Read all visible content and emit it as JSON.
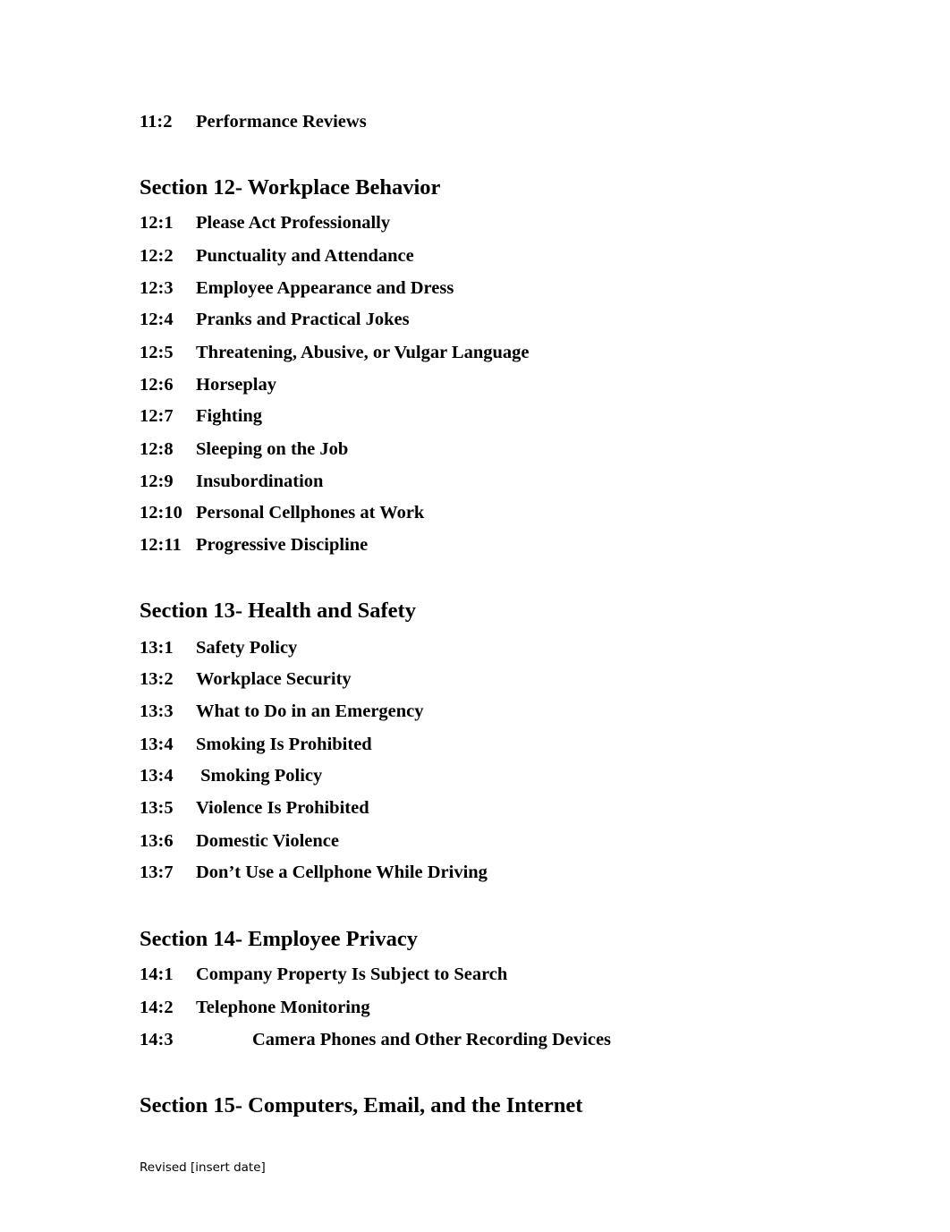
{
  "document": {
    "intro_entries": [
      {
        "num": "11:2",
        "title": "Performance Reviews"
      }
    ],
    "sections": [
      {
        "heading": "Section 12- Workplace Behavior",
        "entries": [
          {
            "num": "12:1",
            "title": "Please Act Professionally"
          },
          {
            "num": "12:2",
            "title": "Punctuality and Attendance"
          },
          {
            "num": "12:3",
            "title": "Employee Appearance and Dress"
          },
          {
            "num": "12:4",
            "title": "Pranks and Practical Jokes"
          },
          {
            "num": "12:5",
            "title": "Threatening, Abusive, or Vulgar Language"
          },
          {
            "num": "12:6",
            "title": "Horseplay"
          },
          {
            "num": "12:7",
            "title": "Fighting"
          },
          {
            "num": "12:8",
            "title": "Sleeping on the Job"
          },
          {
            "num": "12:9",
            "title": "Insubordination"
          },
          {
            "num": "12:10",
            "title": "Personal Cellphones at Work"
          },
          {
            "num": "12:11",
            "title": "Progressive Discipline"
          }
        ]
      },
      {
        "heading": "Section 13- Health and Safety",
        "entries": [
          {
            "num": "13:1",
            "title": "Safety Policy"
          },
          {
            "num": "13:2",
            "title": "Workplace Security"
          },
          {
            "num": "13:3",
            "title": "What to Do in an Emergency"
          },
          {
            "num": "13:4",
            "title": "Smoking Is Prohibited"
          },
          {
            "num": "13:4",
            "title": " Smoking Policy"
          },
          {
            "num": "13:5",
            "title": "Violence Is Prohibited"
          },
          {
            "num": "13:6",
            "title": "Domestic Violence"
          },
          {
            "num": "13:7",
            "title": "Don’t Use a Cellphone While Driving"
          }
        ]
      },
      {
        "heading": "Section 14- Employee Privacy",
        "entries": [
          {
            "num": "14:1",
            "title": "Company Property Is Subject to Search"
          },
          {
            "num": "14:2",
            "title": "Telephone Monitoring"
          },
          {
            "num": "14:3",
            "title": "Camera Phones and Other Recording Devices"
          }
        ]
      },
      {
        "heading": "Section 15- Computers, Email, and the Internet",
        "entries": []
      }
    ],
    "footer": "Revised [insert date]"
  }
}
